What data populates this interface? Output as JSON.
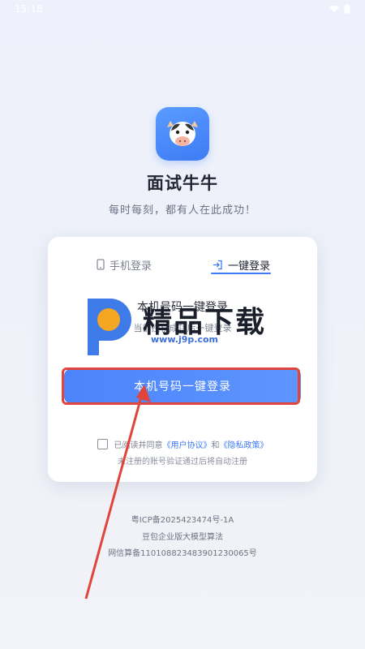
{
  "status_bar": {
    "time": "15:18"
  },
  "app": {
    "name": "面试牛牛",
    "slogan": "每时每刻，都有人在此成功！"
  },
  "tabs": [
    {
      "label": "手机登录",
      "active": false
    },
    {
      "label": "一键登录",
      "active": true
    }
  ],
  "card": {
    "info_title": "本机号码一键登录",
    "info_sub": "当前授权成功后一键登录",
    "login_button": "本机号码一键登录",
    "agree_prefix": "已阅读并同意",
    "user_agreement": "《用户协议》",
    "and": "和",
    "privacy_policy": "《隐私政策》",
    "agree_note": "未注册的账号验证通过后将自动注册"
  },
  "footer": {
    "icp": "粤ICP备2025423474号-1A",
    "model": "豆包企业版大模型算法",
    "algorithm": "网信算备110108823483901230065号"
  },
  "watermark": {
    "text": "精品下载",
    "url": "www.j9p.com"
  },
  "colors": {
    "accent": "#3d7bf5",
    "annotation_red": "#e0443a"
  }
}
